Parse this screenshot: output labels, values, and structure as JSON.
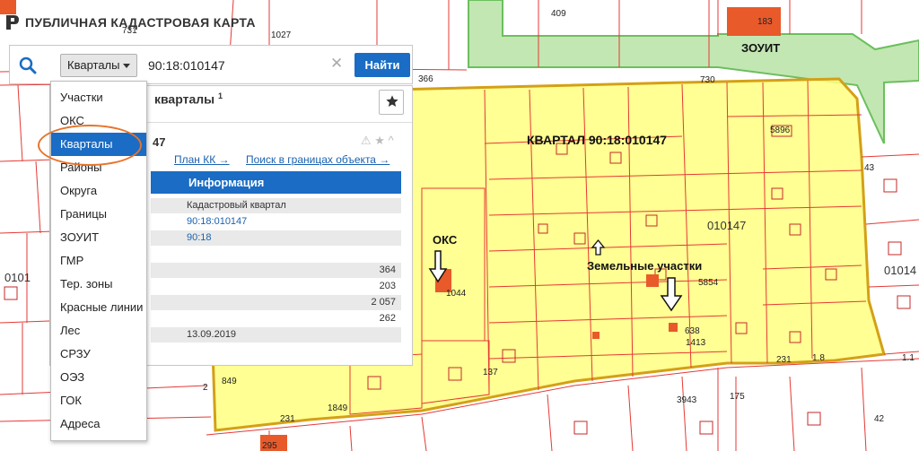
{
  "header": {
    "title": "ПУБЛИЧНАЯ КАДАСТРОВАЯ КАРТА"
  },
  "search": {
    "type_label": "Кварталы",
    "query": "90:18:010147",
    "find_label": "Найти"
  },
  "dropdown": {
    "items": [
      "Участки",
      "ОКС",
      "Кварталы",
      "Районы",
      "Округа",
      "Границы",
      "ЗОУИТ",
      "ГМР",
      "Тер. зоны",
      "Красные линии",
      "Лес",
      "СРЗУ",
      "ОЭЗ",
      "ГОК",
      "Адреса"
    ],
    "selected": "Кварталы"
  },
  "results": {
    "title": "кварталы",
    "count": "1",
    "card_id_fragment": "47",
    "link_plan": "План КК →",
    "link_search": "Поиск в границах объекта →",
    "info_header": "Информация",
    "rows": [
      {
        "value": "Кадастровый квартал",
        "right": "",
        "kind": "text",
        "shade": true
      },
      {
        "value": "90:18:010147",
        "right": "",
        "kind": "link",
        "shade": false
      },
      {
        "value": "90:18",
        "right": "",
        "kind": "link",
        "shade": true
      },
      {
        "value": "",
        "right": "",
        "kind": "text",
        "shade": false
      },
      {
        "value": "",
        "right": "364",
        "kind": "text",
        "shade": true
      },
      {
        "value": "",
        "right": "203",
        "kind": "text",
        "shade": false
      },
      {
        "value": "",
        "right": "2 057",
        "kind": "text",
        "shade": true
      },
      {
        "value": "",
        "right": "262",
        "kind": "text",
        "shade": false
      },
      {
        "value": "13.09.2019",
        "right": "",
        "kind": "text",
        "shade": true
      }
    ]
  },
  "map": {
    "annotations": {
      "quarter": "КВАРТАЛ 90:18:010147",
      "oks": "ОКС",
      "land": "Земельные участки",
      "zouit": "ЗОУИТ"
    },
    "labels": [
      "409",
      "183",
      "730",
      "731",
      "366",
      "1027",
      "1044",
      "1849",
      "137",
      "849",
      "231",
      "638",
      "1413",
      "5854",
      "5896",
      "3943",
      "1.8",
      "43",
      "010147",
      "01014",
      "0101",
      "295",
      "2",
      "42",
      "175",
      "231",
      "1.1"
    ],
    "colors": {
      "quarter_fill": "#ffff80",
      "quarter_border": "#d4a017",
      "parcel_line": "#e53935",
      "zouit": "#7bc96f",
      "selection_ring": "#e8732a",
      "accent": "#1a6cc4"
    }
  }
}
